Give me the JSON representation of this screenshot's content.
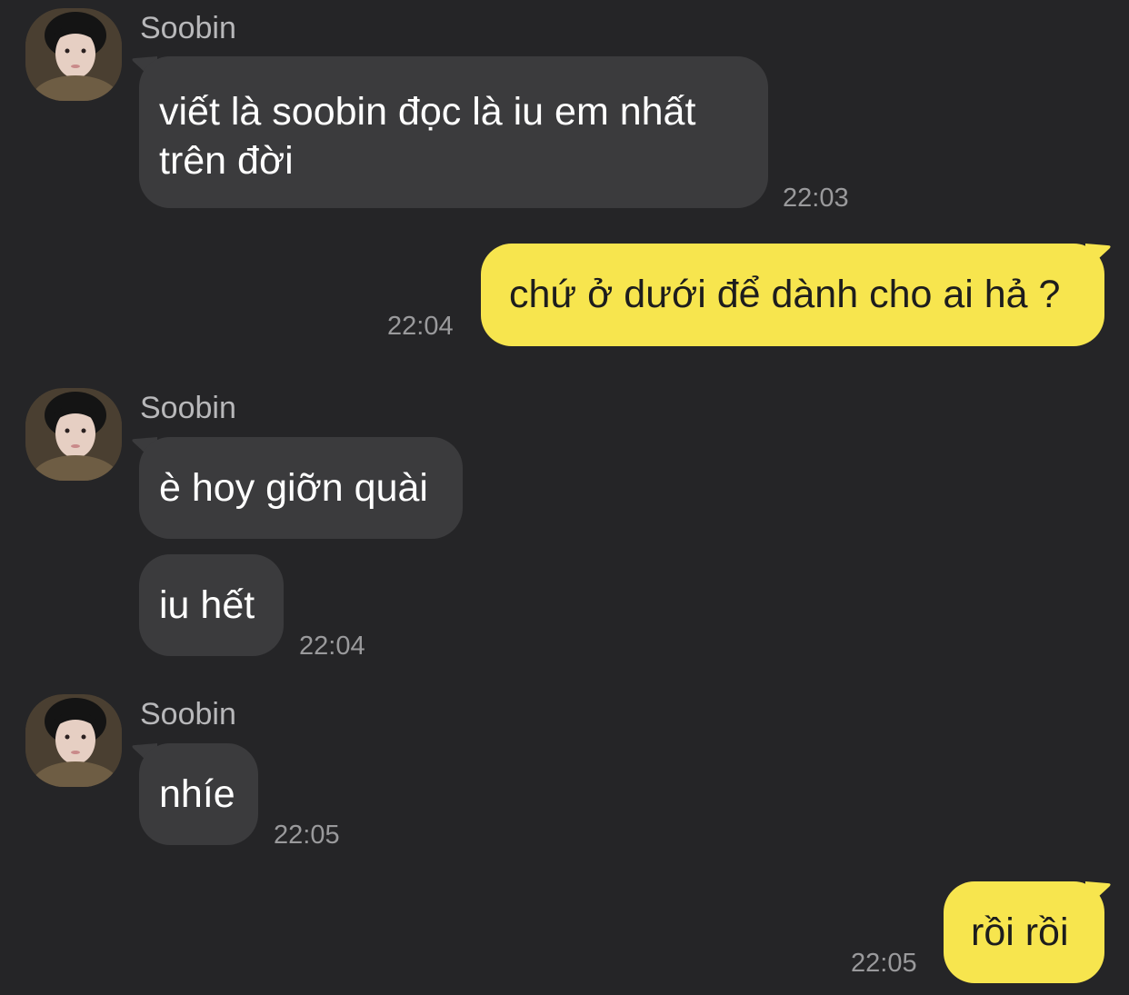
{
  "chat": {
    "groups": [
      {
        "sender": "Soobin",
        "avatar_icon": "user-avatar-icon",
        "messages": [
          {
            "text": "viết là soobin đọc là iu em nhất trên đời",
            "line1": "viết là soobin đọc là iu em nhất",
            "line2": "trên đời",
            "time": "22:03"
          }
        ]
      },
      {
        "outgoing": true,
        "messages": [
          {
            "text": "chứ ở dưới để dành cho ai hả ?",
            "time": "22:04"
          }
        ]
      },
      {
        "sender": "Soobin",
        "avatar_icon": "user-avatar-icon",
        "messages": [
          {
            "text": "è hoy giỡn quài"
          },
          {
            "text": "iu hết",
            "time": "22:04"
          }
        ]
      },
      {
        "sender": "Soobin",
        "avatar_icon": "user-avatar-icon",
        "messages": [
          {
            "text": "nhíe",
            "time": "22:05"
          }
        ]
      },
      {
        "outgoing": true,
        "messages": [
          {
            "text": "rồi rồi",
            "time": "22:05"
          }
        ]
      }
    ]
  },
  "colors": {
    "background": "#252527",
    "incoming_bubble": "#3b3b3d",
    "outgoing_bubble": "#f7e54e",
    "timestamp": "#9a9a9c",
    "sender_name": "#b8b8ba"
  }
}
